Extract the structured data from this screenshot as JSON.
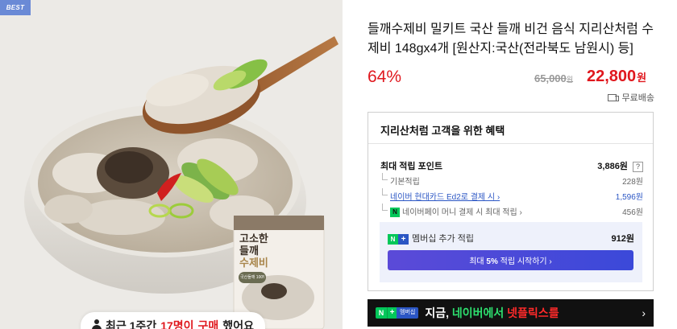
{
  "photo": {
    "badge": "BEST",
    "package": {
      "title_line1": "고소한",
      "title_line2": "들깨",
      "title_line3": "수제비",
      "sticker": "국산들깨 100%"
    },
    "buyer_notice": {
      "prefix": "최근 1주간",
      "count": "17명이",
      "action": "구매",
      "suffix": "했어요"
    }
  },
  "product": {
    "title": "들깨수제비 밀키트 국산 들깨 비건 음식 지리산처럼 수제비 148gx4개 [원산지:국산(전라북도 남원시) 등]",
    "discount_rate": "64%",
    "original_price": "65,000",
    "original_unit": "원",
    "sale_price": "22,800",
    "sale_unit": "원",
    "shipping": "무료배송"
  },
  "benefit": {
    "heading": "지리산처럼 고객을 위한 혜택",
    "max_points_label": "최대 적립 포인트",
    "max_points_value": "3,886원",
    "help_label": "?",
    "rows": [
      {
        "label": "기본적립",
        "value": "228원"
      },
      {
        "label": "네이버 현대카드 Ed2로 결제 시 ›",
        "value": "1,596원"
      },
      {
        "label": "네이버페이 머니 결제 시 최대 적립 ›",
        "value": "456원"
      }
    ],
    "npay_badge": "N",
    "membership": {
      "badge_n": "N",
      "badge_plus": "+",
      "label": "멤버십 추가 적립",
      "value": "912원",
      "button_prefix": "최대",
      "button_bold": "5%",
      "button_suffix": "적립 시작하기 ›"
    }
  },
  "banner": {
    "badge_n": "N",
    "badge_plus": "+",
    "badge_text": "멤버십",
    "text_1": "지금,",
    "text_2": "네이버에서",
    "text_3": "넷플릭스를",
    "chevron": "›"
  },
  "colors": {
    "accent_red": "#e0181e",
    "naver_green": "#03c75a",
    "link_blue": "#2b56c4",
    "best_badge": "#6a8ad6"
  }
}
